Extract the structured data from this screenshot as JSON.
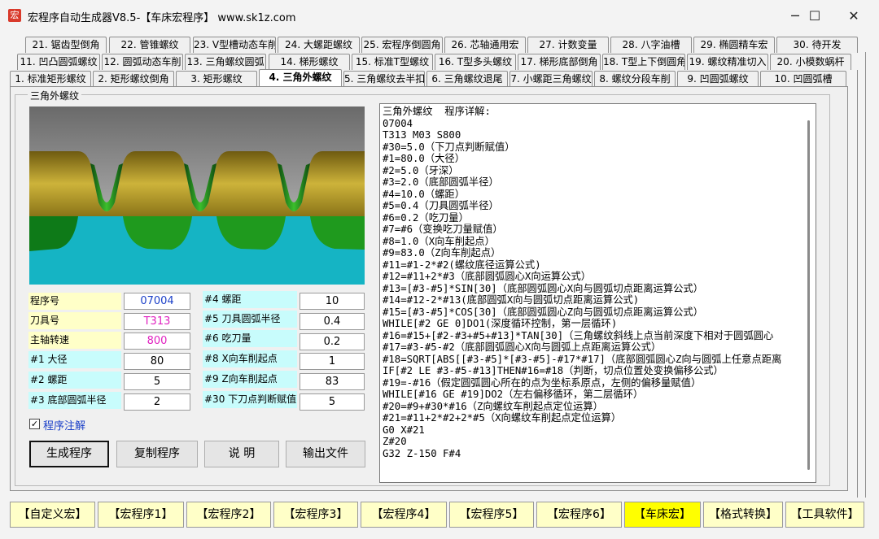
{
  "window": {
    "icon_glyph": "宏",
    "title": "宏程序自动生成器V8.5-【车床宏程序】  www.sk1z.com",
    "minimize": "─",
    "maximize": "☐",
    "close": "✕"
  },
  "tabs_row3": [
    "21. 锯齿型倒角",
    "22. 管锥螺纹",
    "23. V型槽动态车削",
    "24. 大螺距螺纹",
    "25. 宏程序倒圆角",
    "26. 芯轴通用宏",
    "27. 计数变量",
    "28. 八字油槽",
    "29. 椭圆精车宏",
    "30. 待开发"
  ],
  "tabs_row2": [
    "11. 凹凸圆弧螺纹",
    "12. 圆弧动态车削",
    "13. 三角螺纹圆弧",
    "14. 梯形螺纹",
    "15. 标准T型螺纹",
    "16. T型多头螺纹",
    "17. 梯形底部倒角",
    "18. T型上下倒圆角",
    "19. 螺纹精准切入",
    "20. 小模数蜗杆"
  ],
  "tabs_row1": [
    "1. 标准矩形螺纹",
    "2. 矩形螺纹倒角",
    "3. 矩形螺纹",
    "4. 三角外螺纹",
    "5. 三角螺纹去半扣",
    "6. 三角螺纹退尾",
    "7. 小螺距三角螺纹",
    "8. 螺纹分段车削",
    "9. 凹圆弧螺纹",
    "10. 凹圆弧槽"
  ],
  "active_tab_index": 3,
  "group_title": "三角外螺纹",
  "params": {
    "prog_no": {
      "label": "程序号",
      "value": "07004",
      "color": "#1a3fc8"
    },
    "tool_no": {
      "label": "刀具号",
      "value": "T313",
      "color": "#e020c0"
    },
    "spindle": {
      "label": "主轴转速",
      "value": "800",
      "color": "#e020c0"
    },
    "p1": {
      "label": "#1  大径",
      "value": "80"
    },
    "p2": {
      "label": "#2  螺距",
      "value": "5"
    },
    "p3": {
      "label": "#3  底部圆弧半径",
      "value": "2"
    },
    "p4": {
      "label": "#4  螺距",
      "value": "10"
    },
    "p5": {
      "label": "#5  刀具圆弧半径",
      "value": "0.4"
    },
    "p6": {
      "label": "#6  吃刀量",
      "value": "0.2"
    },
    "p8": {
      "label": "#8  X向车削起点",
      "value": "1"
    },
    "p9": {
      "label": "#9  Z向车削起点",
      "value": "83"
    },
    "p30": {
      "label": "#30  下刀点判断赋值",
      "value": "5"
    }
  },
  "annotate": {
    "checked": "✓",
    "label": "程序注解"
  },
  "buttons": {
    "generate": "生成程序",
    "copy": "复制程序",
    "help": "说  明",
    "export": "输出文件"
  },
  "code_lines": [
    "三角外螺纹  程序详解:",
    "07004",
    "T313 M03 S800",
    "#30=5.0（下刀点判断赋值）",
    "#1=80.0（大径）",
    "#2=5.0（牙深）",
    "#3=2.0（底部圆弧半径）",
    "#4=10.0（螺距）",
    "#5=0.4（刀具圆弧半径）",
    "#6=0.2（吃刀量）",
    "#7=#6（变换吃刀量赋值）",
    "#8=1.0（X向车削起点）",
    "#9=83.0（Z向车削起点）",
    "#11=#1-2*#2(螺纹底径运算公式)",
    "#12=#11+2*#3（底部圆弧圆心X向运算公式）",
    "#13=[#3-#5]*SIN[30]（底部圆弧圆心X向与圆弧切点距离运算公式）",
    "#14=#12-2*#13(底部圆弧X向与圆弧切点距离运算公式)",
    "#15=[#3-#5]*COS[30]（底部圆弧圆心Z向与圆弧切点距离运算公式）",
    "WHILE[#2 GE 0]DO1(深度循环控制，第一层循环)",
    "#16=#15+[#2-#3+#5+#13]*TAN[30]（三角螺纹斜线上点当前深度下相对于圆弧圆心",
    "#17=#3-#5-#2（底部圆弧圆心X向与圆弧上点距离运算公式）",
    "#18=SQRT[ABS[[#3-#5]*[#3-#5]-#17*#17]（底部圆弧圆心Z向与圆弧上任意点距离",
    "IF[#2 LE #3-#5-#13]THEN#16=#18（判断，切点位置处变换偏移公式）",
    "#19=-#16（假定圆弧圆心所在的点为坐标系原点，左侧的偏移量赋值）",
    "WHILE[#16 GE #19]DO2（左右偏移循环，第二层循环）",
    "#20=#9+#30*#16（Z向螺纹车削起点定位运算）",
    "#21=#11+2*#2+2*#5（X向螺纹车削起点定位运算）",
    "G0 X#21",
    "Z#20",
    "G32 Z-150 F#4"
  ],
  "bottom_buttons": [
    "【自定义宏】",
    "【宏程序1】",
    "【宏程序2】",
    "【宏程序3】",
    "【宏程序4】",
    "【宏程序5】",
    "【宏程序6】",
    "【车床宏】",
    "【格式转换】",
    "【工具软件】"
  ],
  "bottom_active_index": 7,
  "colors": {
    "label_yellow": "#ffffc8",
    "label_cyan": "#c8fcfc",
    "bottom_active": "#ffff00"
  }
}
